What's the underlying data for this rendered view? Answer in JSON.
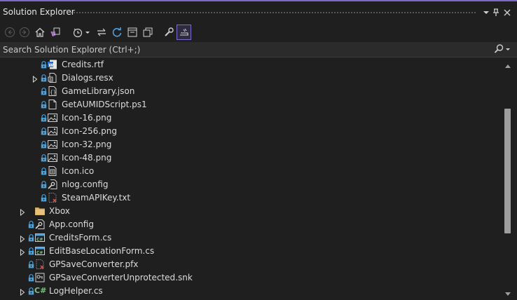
{
  "panel": {
    "title": "Solution Explorer",
    "title_buttons": [
      {
        "name": "window-position-icon",
        "glyph": "▾"
      },
      {
        "name": "pin-icon",
        "glyph": "📌"
      },
      {
        "name": "close-icon",
        "glyph": "✕"
      }
    ]
  },
  "toolbar": {
    "items": [
      "back-icon",
      "forward-icon",
      "home-icon",
      "switch-views-icon",
      "pending-changes-filter-icon",
      "dropdown-arrow-icon",
      "sync-active-document-icon",
      "refresh-icon",
      "collapse-all-icon",
      "show-all-files-icon",
      "properties-wrench-icon",
      "preview-selected-items-icon"
    ]
  },
  "search": {
    "placeholder": "Search Solution Explorer (Ctrl+;)",
    "value": ""
  },
  "tree": {
    "items": [
      {
        "label": "Credits.rtf",
        "icon": "word-document-icon",
        "level": 2,
        "expandable": false,
        "locked": true
      },
      {
        "label": "Dialogs.resx",
        "icon": "resx-file-icon",
        "level": 2,
        "expandable": true,
        "locked": true
      },
      {
        "label": "GameLibrary.json",
        "icon": "json-file-icon",
        "level": 2,
        "expandable": false,
        "locked": true
      },
      {
        "label": "GetAUMIDScript.ps1",
        "icon": "text-file-icon",
        "level": 2,
        "expandable": false,
        "locked": true
      },
      {
        "label": "Icon-16.png",
        "icon": "image-file-icon",
        "level": 2,
        "expandable": false,
        "locked": true
      },
      {
        "label": "Icon-256.png",
        "icon": "image-file-icon",
        "level": 2,
        "expandable": false,
        "locked": true
      },
      {
        "label": "Icon-32.png",
        "icon": "image-file-icon",
        "level": 2,
        "expandable": false,
        "locked": true
      },
      {
        "label": "Icon-48.png",
        "icon": "image-file-icon",
        "level": 2,
        "expandable": false,
        "locked": true
      },
      {
        "label": "Icon.ico",
        "icon": "ico-file-icon",
        "level": 2,
        "expandable": false,
        "locked": true
      },
      {
        "label": "nlog.config",
        "icon": "config-file-icon",
        "level": 2,
        "expandable": false,
        "locked": true
      },
      {
        "label": "SteamAPIKey.txt",
        "icon": "excluded-file-icon",
        "level": 2,
        "expandable": false,
        "locked": true
      },
      {
        "label": "Xbox",
        "icon": "folder-icon",
        "level": 1,
        "expandable": true,
        "locked": false
      },
      {
        "label": "App.config",
        "icon": "config-file-icon",
        "level": 1,
        "expandable": false,
        "locked": true
      },
      {
        "label": "CreditsForm.cs",
        "icon": "form-file-icon",
        "level": 1,
        "expandable": true,
        "locked": true
      },
      {
        "label": "EditBaseLocationForm.cs",
        "icon": "form-file-icon",
        "level": 1,
        "expandable": true,
        "locked": true
      },
      {
        "label": "GPSaveConverter.pfx",
        "icon": "excluded-file-icon",
        "level": 1,
        "expandable": false,
        "locked": true
      },
      {
        "label": "GPSaveConverterUnprotected.snk",
        "icon": "key-file-icon",
        "level": 1,
        "expandable": false,
        "locked": true
      },
      {
        "label": "LogHelper.cs",
        "icon": "csharp-file-icon",
        "level": 1,
        "expandable": true,
        "locked": true,
        "prefix": "C#"
      }
    ]
  },
  "colors": {
    "background": "#1f1f1f",
    "accent": "#7f6ac9",
    "lock_blue": "#4aa3df",
    "text": "#dcdcdc"
  }
}
